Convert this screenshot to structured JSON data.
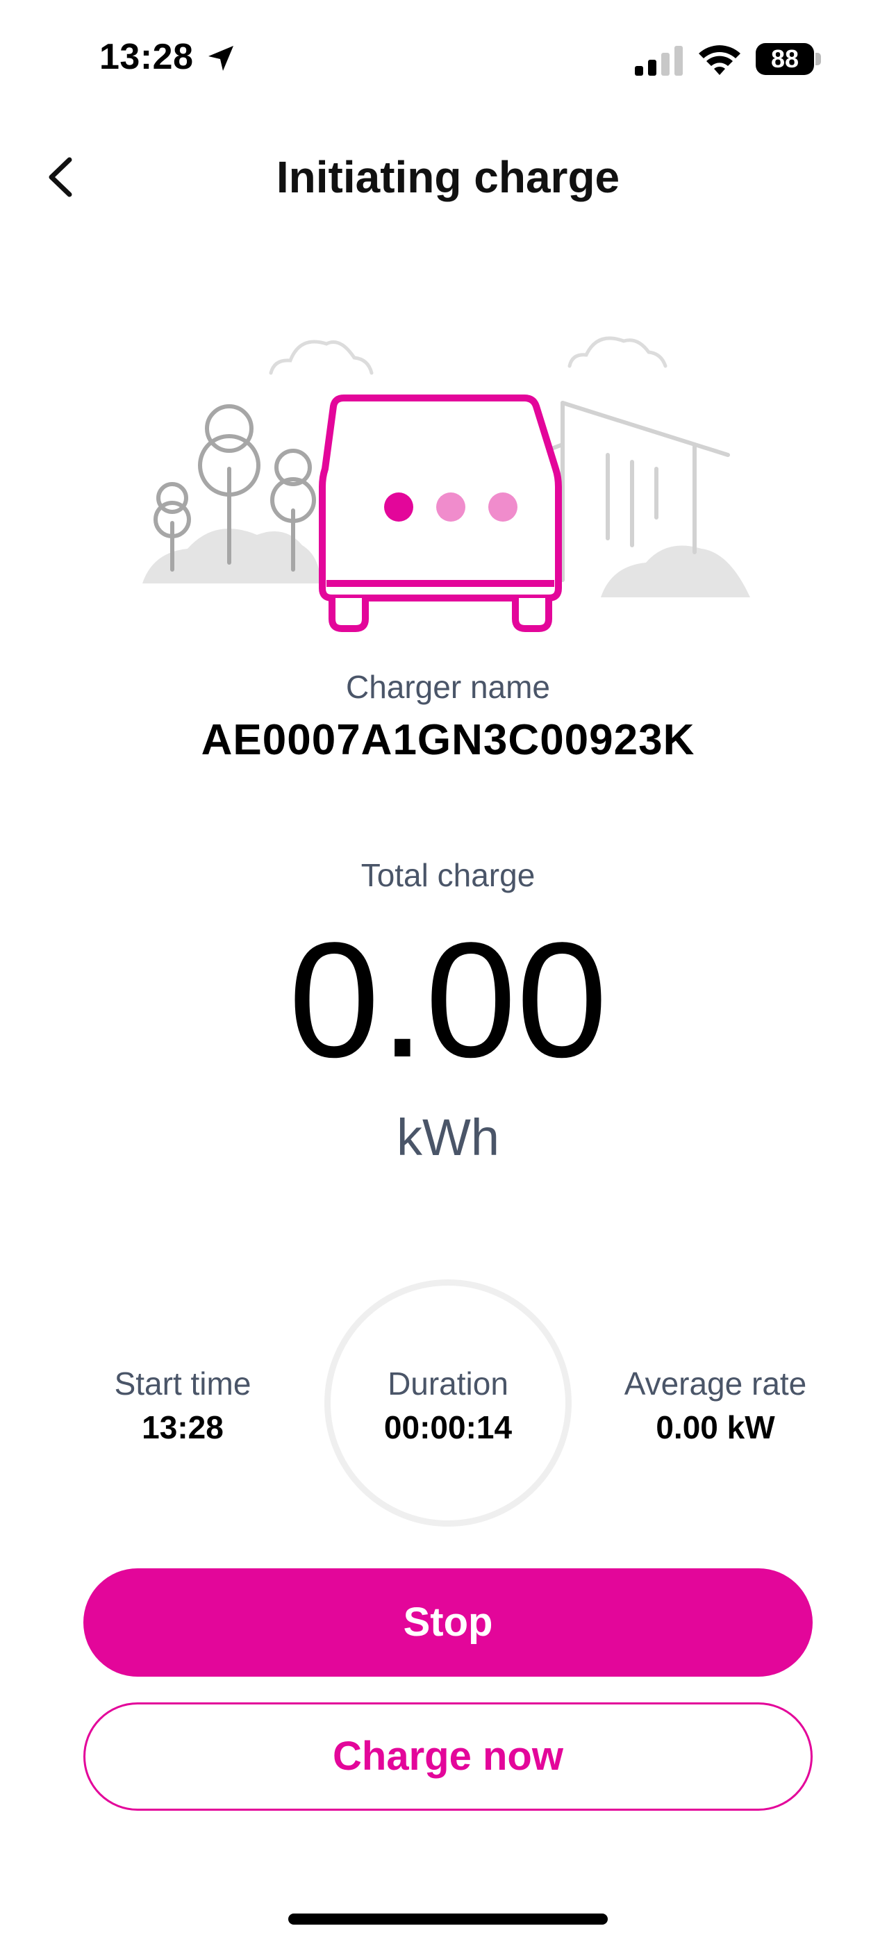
{
  "status_bar": {
    "time": "13:28",
    "battery": "88",
    "icons": [
      "location-arrow-icon",
      "cellular-signal-icon",
      "wifi-icon",
      "battery-icon"
    ]
  },
  "header": {
    "title": "Initiating charge",
    "back_icon": "chevron-left-icon"
  },
  "illustration": {
    "icon": "car-charging-illustration",
    "accent_color": "#e3069a",
    "dot_light_color": "#f08ccc"
  },
  "charger": {
    "label": "Charger name",
    "name": "AE0007A1GN3C00923K"
  },
  "total_charge": {
    "label": "Total charge",
    "value": "0.00",
    "unit": "kWh"
  },
  "stats": {
    "start_time": {
      "label": "Start time",
      "value": "13:28"
    },
    "duration": {
      "label": "Duration",
      "value": "00:00:14"
    },
    "average_rate": {
      "label": "Average rate",
      "value": "0.00 kW"
    }
  },
  "actions": {
    "stop_label": "Stop",
    "charge_now_label": "Charge now"
  },
  "colors": {
    "brand": "#e3069a",
    "secondary_text": "#4a5568",
    "ring": "#efefef"
  }
}
